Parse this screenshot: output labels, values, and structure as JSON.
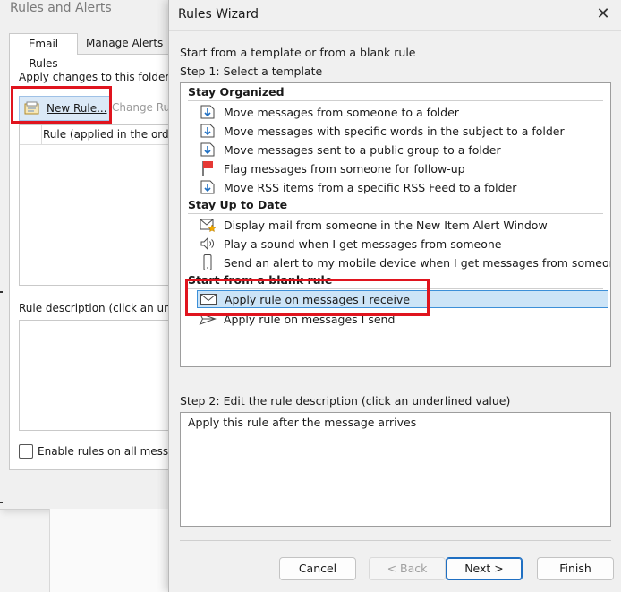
{
  "rules_alerts": {
    "title": "Rules and Alerts",
    "tabs": [
      "Email Rules",
      "Manage Alerts"
    ],
    "apply_label": "Apply changes to this folder:",
    "new_rule_label": "New Rule...",
    "change_rule_label": "Change Rul",
    "rule_column_header": "Rule (applied in the orde",
    "description_label": "Rule description (click an und",
    "enable_label": "Enable rules on all messa"
  },
  "wizard": {
    "title": "Rules Wizard",
    "close_glyph": "✕",
    "subtitle": "Start from a template or from a blank rule",
    "step1_label": "Step 1: Select a template",
    "groups": [
      {
        "name": "Stay Organized",
        "items": [
          {
            "label": "Move messages from someone to a folder",
            "icon": "move-folder-icon"
          },
          {
            "label": "Move messages with specific words in the subject to a folder",
            "icon": "move-folder-icon"
          },
          {
            "label": "Move messages sent to a public group to a folder",
            "icon": "move-folder-icon"
          },
          {
            "label": "Flag messages from someone for follow-up",
            "icon": "flag-icon"
          },
          {
            "label": "Move RSS items from a specific RSS Feed to a folder",
            "icon": "move-folder-icon"
          }
        ]
      },
      {
        "name": "Stay Up to Date",
        "items": [
          {
            "label": "Display mail from someone in the New Item Alert Window",
            "icon": "new-item-alert-icon"
          },
          {
            "label": "Play a sound when I get messages from someone",
            "icon": "speaker-icon"
          },
          {
            "label": "Send an alert to my mobile device when I get messages from someone",
            "icon": "mobile-device-icon"
          }
        ]
      },
      {
        "name": "Start from a blank rule",
        "items": [
          {
            "label": "Apply rule on messages I receive",
            "icon": "envelope-icon",
            "selected": true
          },
          {
            "label": "Apply rule on messages I send",
            "icon": "send-icon"
          }
        ]
      }
    ],
    "step2_label": "Step 2: Edit the rule description (click an underlined value)",
    "description_text": "Apply this rule after the message arrives",
    "buttons": {
      "cancel": "Cancel",
      "back": "< Back",
      "next": "Next >",
      "finish": "Finish"
    }
  },
  "colors": {
    "highlight_red": "#e0141e",
    "selection_fill": "#cce4f7",
    "selection_border": "#3c8fd8"
  }
}
